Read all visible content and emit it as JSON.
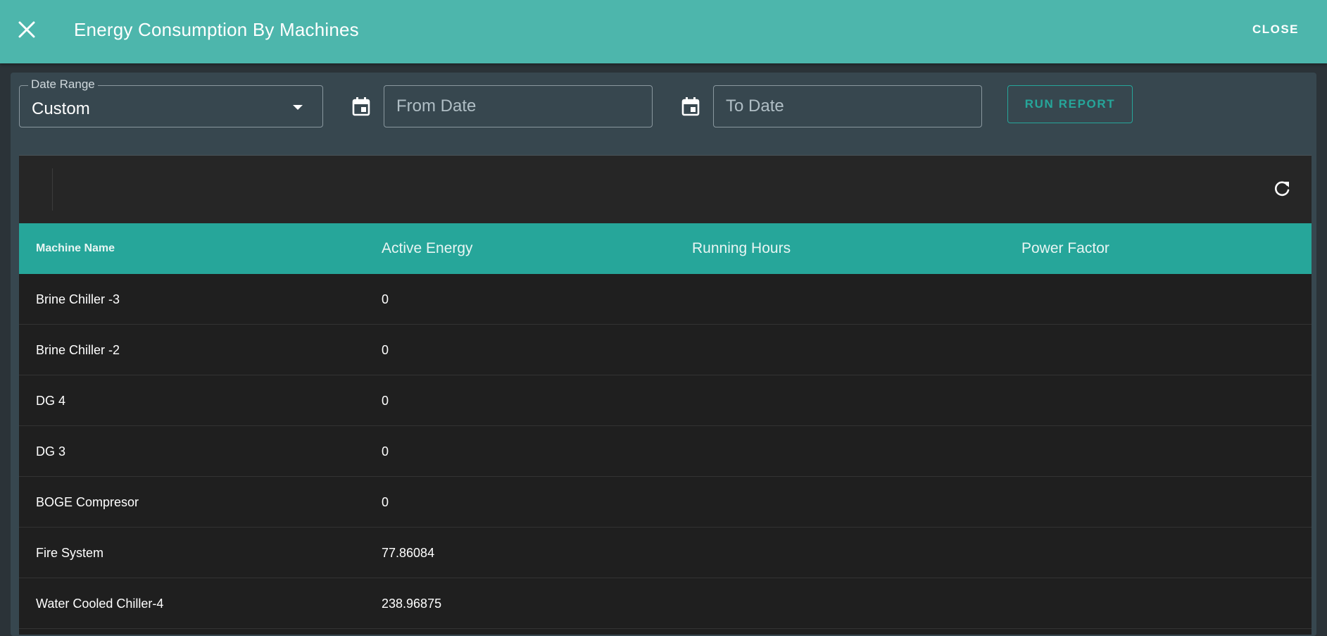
{
  "header": {
    "title": "Energy Consumption By Machines",
    "close_label": "CLOSE",
    "bg_color": "#4db6ac"
  },
  "filters": {
    "date_range": {
      "label": "Date Range",
      "value": "Custom"
    },
    "from_date": {
      "placeholder": "From Date",
      "value": ""
    },
    "to_date": {
      "placeholder": "To Date",
      "value": ""
    },
    "run_report_label": "RUN REPORT"
  },
  "table": {
    "header_color": "#26a69a",
    "columns": [
      "Machine Name",
      "Active Energy",
      "Running Hours",
      "Power Factor"
    ],
    "rows": [
      {
        "machine": "Brine Chiller -3",
        "active_energy": "0",
        "running_hours": "",
        "power_factor": ""
      },
      {
        "machine": "Brine Chiller -2",
        "active_energy": "0",
        "running_hours": "",
        "power_factor": ""
      },
      {
        "machine": "DG 4",
        "active_energy": "0",
        "running_hours": "",
        "power_factor": ""
      },
      {
        "machine": "DG 3",
        "active_energy": "0",
        "running_hours": "",
        "power_factor": ""
      },
      {
        "machine": "BOGE Compresor",
        "active_energy": "0",
        "running_hours": "",
        "power_factor": ""
      },
      {
        "machine": "Fire System",
        "active_energy": "77.86084",
        "running_hours": "",
        "power_factor": ""
      },
      {
        "machine": "Water Cooled Chiller-4",
        "active_energy": "238.96875",
        "running_hours": "",
        "power_factor": ""
      }
    ]
  },
  "icons": {
    "close": "close-icon",
    "calendar": "calendar-icon",
    "dropdown": "chevron-down-icon",
    "refresh": "refresh-icon"
  }
}
